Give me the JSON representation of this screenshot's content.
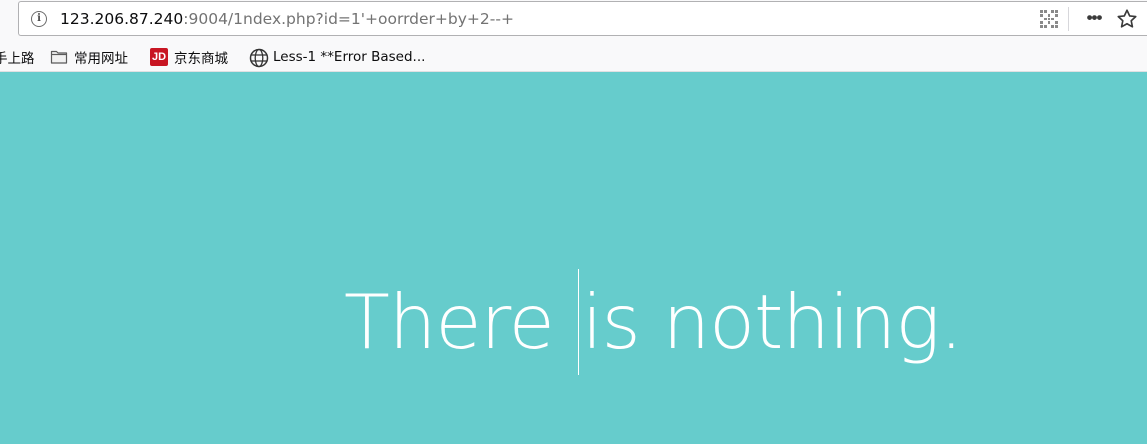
{
  "browser": {
    "url_host": "123.206.87.240",
    "url_rest": ":9004/1ndex.php?id=1'+oorrder+by+2--+",
    "icons": {
      "site_info": "info-icon",
      "qr": "qr-code-icon",
      "more": "more-actions-icon",
      "bookmark": "star-icon"
    },
    "more_glyph": "•••",
    "info_glyph": "i"
  },
  "bookmarks": [
    {
      "label": "手上路",
      "icon": "none"
    },
    {
      "label": "常用网址",
      "icon": "folder-icon"
    },
    {
      "label": "京东商城",
      "icon": "jd-logo-icon",
      "icon_text": "JD"
    },
    {
      "label": "Less-1 **Error Based...",
      "icon": "globe-icon"
    }
  ],
  "page": {
    "background": "#66cccc",
    "text_color": "#ffffff",
    "headline_before_caret": "There",
    "headline_after_caret": "is nothing."
  }
}
